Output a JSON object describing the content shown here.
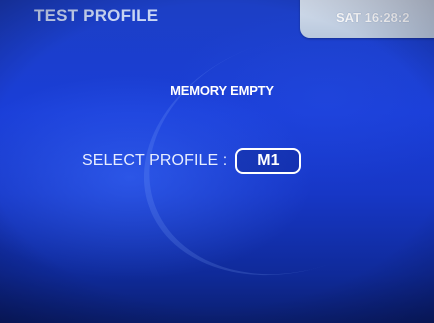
{
  "header": {
    "title": "TEST PROFILE",
    "datetime": "SAT 16:28:2"
  },
  "main": {
    "status_message": "MEMORY EMPTY",
    "select_label": "SELECT PROFILE :",
    "selected_profile": "M1"
  },
  "colors": {
    "background": "#1a3ed8",
    "text": "#ffffff",
    "clock_panel": "#c9d5e7"
  }
}
